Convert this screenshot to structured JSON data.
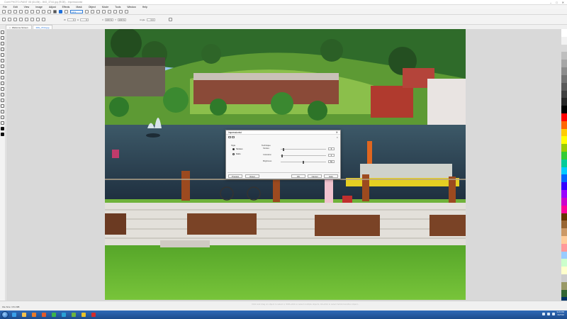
{
  "window": {
    "title": "Corel PHOTO-PAINT X8 (64-Bit) - IMG_3744.jpg (RGB) - Impressionist",
    "buttons": [
      "–",
      "□",
      "✕"
    ]
  },
  "menu": [
    "File",
    "Edit",
    "View",
    "Image",
    "Adjust",
    "Effects",
    "Mask",
    "Object",
    "Movie",
    "Tools",
    "Window",
    "Help"
  ],
  "toolbar1": {
    "zoom_value": "12%"
  },
  "toolbar2": {
    "fields": [
      {
        "label": "W",
        "value": "0"
      },
      {
        "label": "H",
        "value": "0"
      },
      {
        "label": "X",
        "value": "100 %"
      },
      {
        "label": "Y",
        "value": "100 %"
      },
      {
        "label": "Angle",
        "value": "0.0"
      }
    ]
  },
  "tabs": [
    {
      "label": "Welcome Screen",
      "active": false
    },
    {
      "label": "IMG_3744.jpg",
      "active": true
    }
  ],
  "dialog": {
    "title": "Impressionist",
    "style_label": "Style",
    "styles": [
      {
        "label": "Strokes",
        "selected": true
      },
      {
        "label": "Dabs",
        "selected": false
      }
    ],
    "technique_label": "Technique",
    "sliders": [
      {
        "label": "Strokes",
        "value": "5",
        "level": 0.05
      },
      {
        "label": "Coloration",
        "value": "2",
        "level": 0.02
      },
      {
        "label": "Brightness",
        "value": "50",
        "level": 0.5
      }
    ],
    "buttons": {
      "preview": "Preview",
      "reset": "Reset",
      "ok": "OK",
      "cancel": "Cancel",
      "help": "Help"
    }
  },
  "status": {
    "file_size": "File Size: 3.51 MB",
    "hint": "Click and drag on object to select it, Shift+click to select multiple objects, Alt+click to select behind another object..."
  },
  "taskbar": {
    "time": "9:23 PM",
    "date": "6/27/16"
  },
  "palette_colors": [
    "#ffffff",
    "#f2f2f2",
    "#d9d9d9",
    "#bfbfbf",
    "#a6a6a6",
    "#8c8c8c",
    "#737373",
    "#595959",
    "#404040",
    "#262626",
    "#000000",
    "#ff0000",
    "#ff6600",
    "#ffcc00",
    "#ffff00",
    "#99cc00",
    "#33cc33",
    "#00cc99",
    "#00ccff",
    "#0066ff",
    "#3300ff",
    "#9900ff",
    "#cc00cc",
    "#ff0099",
    "#663300",
    "#996633",
    "#cc9966",
    "#ffcc99",
    "#ff9999",
    "#99ccff",
    "#ccffcc",
    "#ffffcc",
    "#cccccc",
    "#999966",
    "#336633",
    "#003366"
  ]
}
